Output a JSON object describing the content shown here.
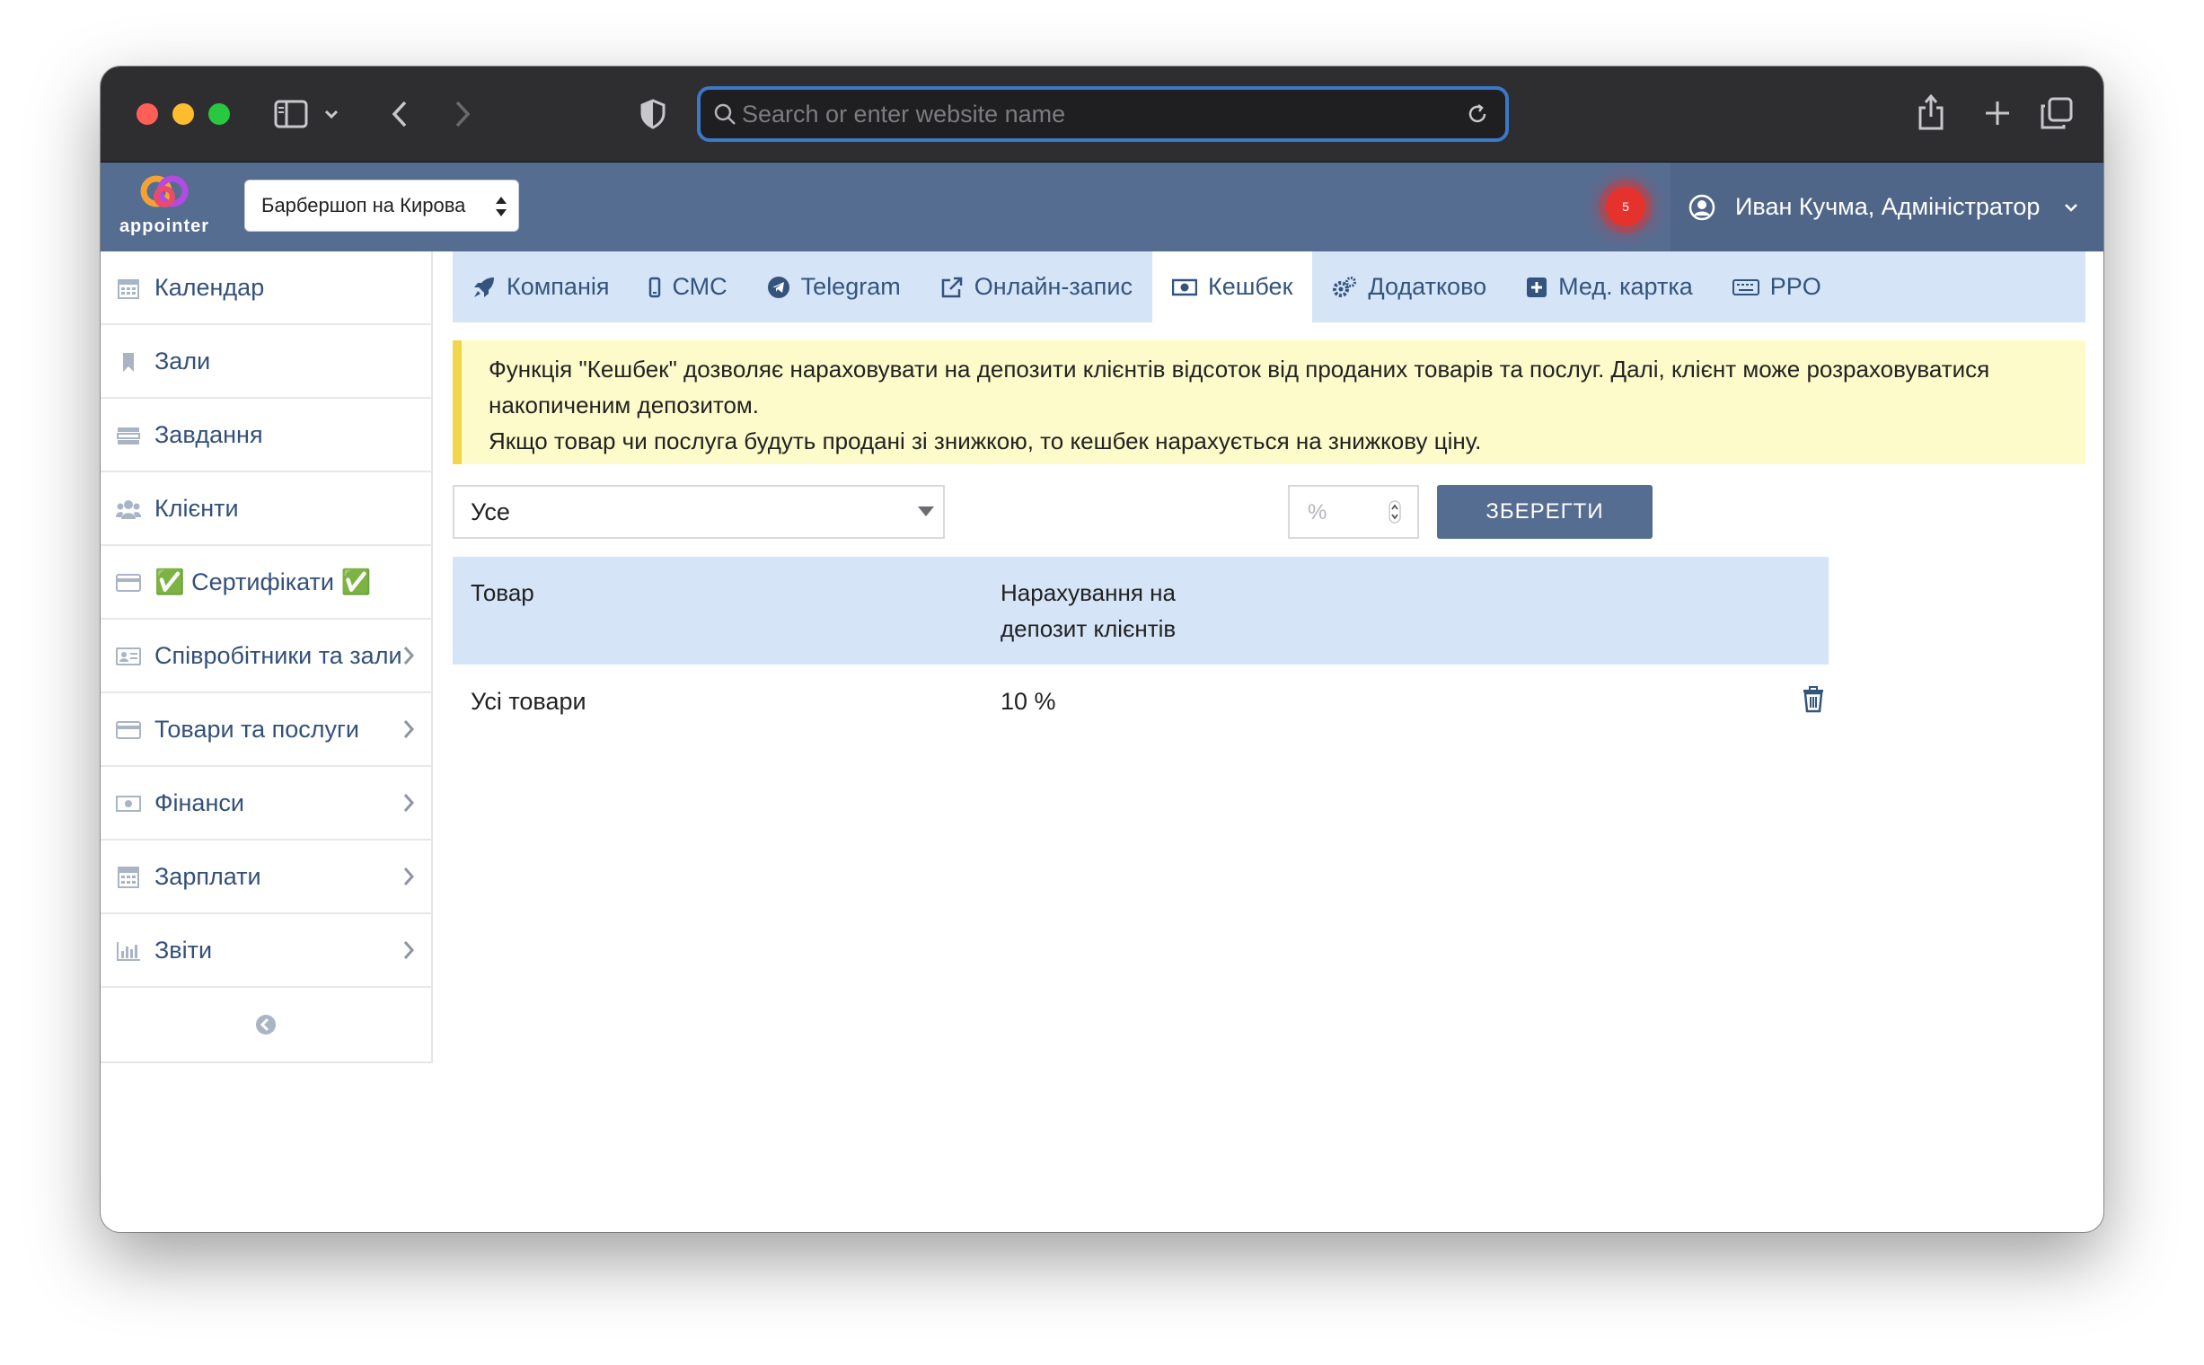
{
  "browser": {
    "url_placeholder": "Search or enter website name"
  },
  "header": {
    "logo_text": "appointer",
    "branch": "Барбершоп на Кирова",
    "notifications_count": "5",
    "user_name": "Иван Кучма, Адміністратор"
  },
  "sidebar": {
    "items": [
      {
        "label": "Календар",
        "icon": "calendar-icon",
        "has_submenu": false
      },
      {
        "label": "Зали",
        "icon": "bookmark-icon",
        "has_submenu": false
      },
      {
        "label": "Завдання",
        "icon": "tasks-icon",
        "has_submenu": false
      },
      {
        "label": "Клієнти",
        "icon": "users-icon",
        "has_submenu": false
      },
      {
        "label": "✅ Сертифікати ✅",
        "icon": "card-icon",
        "has_submenu": false
      },
      {
        "label": "Співробітники та зали",
        "icon": "id-card-icon",
        "has_submenu": true
      },
      {
        "label": "Товари та послуги",
        "icon": "card-icon",
        "has_submenu": true
      },
      {
        "label": "Фінанси",
        "icon": "money-icon",
        "has_submenu": true
      },
      {
        "label": "Зарплати",
        "icon": "calculator-icon",
        "has_submenu": true
      },
      {
        "label": "Звіти",
        "icon": "bar-chart-icon",
        "has_submenu": true
      }
    ]
  },
  "tabs": [
    {
      "label": "Компанія",
      "icon": "rocket-icon",
      "active": false
    },
    {
      "label": "СМС",
      "icon": "mobile-icon",
      "active": false
    },
    {
      "label": "Telegram",
      "icon": "telegram-icon",
      "active": false
    },
    {
      "label": "Онлайн-запис",
      "icon": "external-link-icon",
      "active": false
    },
    {
      "label": "Кешбек",
      "icon": "money-icon",
      "active": true
    },
    {
      "label": "Додатково",
      "icon": "gears-icon",
      "active": false
    },
    {
      "label": "Мед. картка",
      "icon": "plus-square-icon",
      "active": false
    },
    {
      "label": "PPO",
      "icon": "keyboard-icon",
      "active": false
    }
  ],
  "alert": {
    "line1": "Функція \"Кешбек\" дозволяє нараховувати на депозити клієнтів відсоток від проданих товарів та послуг. Далі, клієнт може розраховуватися накопиченим депозитом.",
    "line2": "Якщо товар чи послуга будуть продані зі знижкою, то кешбек нарахується на знижкову ціну."
  },
  "form": {
    "product_select_value": "Усе",
    "percent_placeholder": "%",
    "save_label": "ЗБЕРЕГТИ"
  },
  "table": {
    "headers": [
      "Товар",
      "Нарахування на депозит клієнтів"
    ],
    "rows": [
      {
        "product": "Усі товари",
        "percent": "10 %"
      }
    ]
  },
  "colors": {
    "brand": "#566d92",
    "tab_bar": "#d5e4f7",
    "alert_bg": "#fdfbc9",
    "url_focus": "#3c78c8"
  }
}
